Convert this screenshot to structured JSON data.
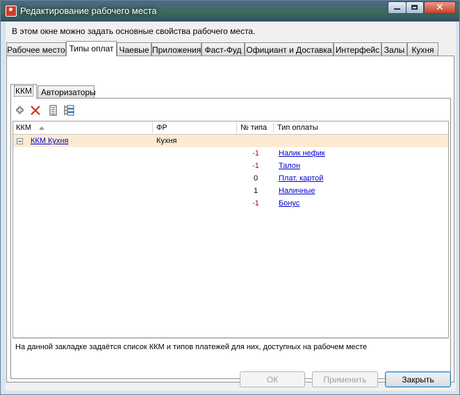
{
  "window": {
    "title": "Редактирование рабочего места",
    "description": "В этом окне можно задать основные свойства рабочего места."
  },
  "tabs": [
    {
      "label": "Рабочее место"
    },
    {
      "label": "Типы оплат"
    },
    {
      "label": "Чаевые"
    },
    {
      "label": "Приложения"
    },
    {
      "label": "Фаст-Фуд"
    },
    {
      "label": "Официант и Доставка"
    },
    {
      "label": "Интерфейс"
    },
    {
      "label": "Залы"
    },
    {
      "label": "Кухня"
    }
  ],
  "active_tab": "Типы оплат",
  "subtabs": [
    {
      "label": "ККМ"
    },
    {
      "label": "Авторизаторы"
    }
  ],
  "toolbar": {
    "icons": [
      "add-icon",
      "delete-icon",
      "collapse-icon",
      "expand-icon"
    ]
  },
  "grid": {
    "columns": [
      "ККМ",
      "ФР",
      "№ типа",
      "Тип оплаты"
    ],
    "group": {
      "kkm": "ККМ Кухня",
      "fr": "Кухня"
    },
    "rows": [
      {
        "num": "-1",
        "type": "Налик нефик",
        "negative": true
      },
      {
        "num": "-1",
        "type": "Талон",
        "negative": true
      },
      {
        "num": "0",
        "type": "Плат. картой",
        "negative": false
      },
      {
        "num": "1",
        "type": "Наличные",
        "negative": false
      },
      {
        "num": "-1",
        "type": "Бонус",
        "negative": true
      }
    ]
  },
  "hint": "На данной закладке задаётся список ККМ и типов платежей для них, доступных на рабочем месте",
  "buttons": {
    "ok": "ОК",
    "apply": "Применить",
    "close": "Закрыть"
  },
  "colors": {
    "group_row": "#fcebd2",
    "link": "#0000cc",
    "negative": "#c00000"
  }
}
